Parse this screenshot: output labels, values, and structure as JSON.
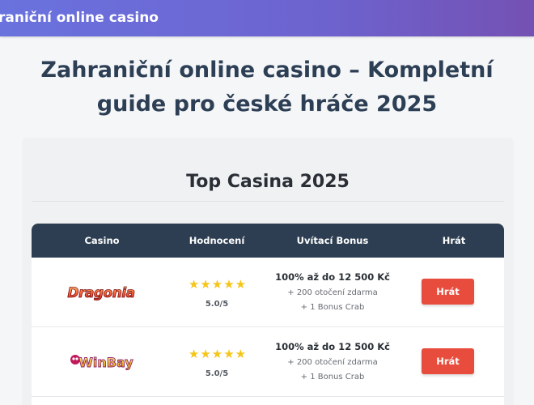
{
  "header": {
    "site_title": "raniční online casino"
  },
  "page": {
    "title": "Zahraniční online casino – Kompletní guide pro české hráče 2025"
  },
  "section": {
    "title": "Top Casina 2025",
    "table": {
      "columns": [
        "Casino",
        "Hodnocení",
        "Uvítací Bonus",
        "Hrát"
      ],
      "rows": [
        {
          "casino": "Dragonia",
          "stars": "★★★★★",
          "rating": "5.0/5",
          "bonus_main": "100% až do 12 500 Kč",
          "bonus_line1": "+ 200 otočení zdarma",
          "bonus_line2": "+ 1 Bonus Crab",
          "button": "Hrát"
        },
        {
          "casino": "WinBay",
          "stars": "★★★★★",
          "rating": "5.0/5",
          "bonus_main": "100% až do 12 500 Kč",
          "bonus_line1": "+ 200 otočení zdarma",
          "bonus_line2": "+ 1 Bonus Crab",
          "button": "Hrát"
        }
      ]
    }
  },
  "colors": {
    "header_gradient_start": "#6a72de",
    "header_gradient_end": "#7451b3",
    "title_text": "#2d3f55",
    "table_header": "#2d3e52",
    "star": "#f5c518",
    "play_button": "#e74c3c"
  }
}
